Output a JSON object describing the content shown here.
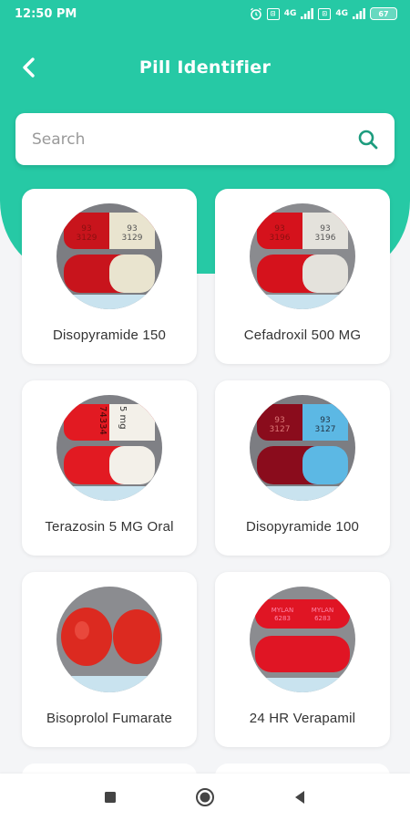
{
  "status_bar": {
    "time": "12:50 PM",
    "battery": "67",
    "sim1": "4G",
    "sim2": "4G"
  },
  "header": {
    "title": "Pill Identifier"
  },
  "search": {
    "placeholder": "Search"
  },
  "pills": [
    {
      "name": "Disopyramide 150",
      "left_color": "#c8141c",
      "right_color": "#e9e4cf",
      "imprint_left": "93 3129",
      "imprint_right": "93 3129"
    },
    {
      "name": "Cefadroxil 500 MG",
      "left_color": "#d5121c",
      "right_color": "#e4e2dc",
      "imprint_left": "93 3196",
      "imprint_right": "93 3196"
    },
    {
      "name": "Terazosin 5 MG Oral",
      "left_color": "#e21a22",
      "right_color": "#f3f0e9",
      "imprint_left": "74334",
      "imprint_right": "5 mg"
    },
    {
      "name": "Disopyramide 100",
      "left_color": "#8a0c1c",
      "right_color": "#5cb8e4",
      "imprint_left": "93 3127",
      "imprint_right": "93 3127"
    },
    {
      "name": "Bisoprolol Fumarate",
      "left_color": "#dc2a20",
      "right_color": "#dc2a20",
      "imprint_left": "",
      "imprint_right": ""
    },
    {
      "name": "24 HR Verapamil",
      "left_color": "#e01524",
      "right_color": "#e01524",
      "imprint_left": "MYLAN 6283",
      "imprint_right": "MYLAN 6283"
    }
  ],
  "icons": {
    "back": "arrow-left-icon",
    "search": "search-icon",
    "nav_recents": "square-icon",
    "nav_home": "circle-icon",
    "nav_back": "triangle-back-icon"
  },
  "colors": {
    "primary": "#26c9a5",
    "accent_icon": "#1d9c7e"
  }
}
